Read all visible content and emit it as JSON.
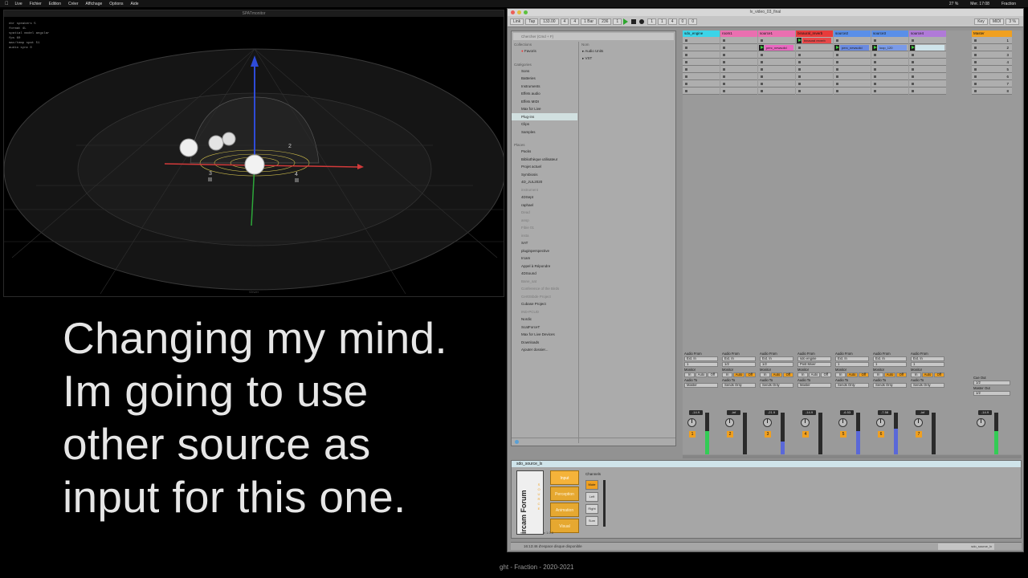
{
  "menubar": {
    "items": [
      "Live",
      "Fichier",
      "Edition",
      "Créer",
      "Affichage",
      "Options",
      "Aide"
    ],
    "status": [
      "27 %",
      "Mer. 17:08",
      "Fraction"
    ]
  },
  "spat": {
    "window_title": "SPATmonitor",
    "info_lines": [
      "nbr speakers 5",
      "format 4L",
      "spatial model angular",
      "fps 60",
      "max/temp spat 51",
      "audio sync 0"
    ],
    "speaker_labels": [
      "2",
      "3",
      "4"
    ],
    "footer": "Viewer"
  },
  "caption": {
    "lines": [
      "Changing my mind.",
      "Im going to use",
      "other source as",
      "input for this one."
    ]
  },
  "credits": "ght - Fraction - 2020-2021",
  "live": {
    "window_title": "lv_video_03_final",
    "control_bar": {
      "items": [
        "Link",
        "Tap",
        "133.00",
        "4",
        "4",
        "1 Bar",
        "236",
        "1",
        "1",
        "1",
        "4",
        "0",
        "0"
      ],
      "key": "Key",
      "midi": "MIDI",
      "cpu": "3 %"
    },
    "browser": {
      "search_placeholder": "Chercher (Cmd + F)",
      "collections_head": "Collections",
      "collections": [
        "Favoris"
      ],
      "categories_head": "Catégories",
      "categories": [
        "Sons",
        "Batteries",
        "Instruments",
        "Effets audio",
        "Effets MIDI",
        "Max for Live",
        "Plug-ins",
        "Clips",
        "Samples"
      ],
      "selected_category": "Plug-ins",
      "places_head": "Places",
      "places": [
        "Packs",
        "Bibliothèque utilisateur",
        "Projet actuel",
        "Symbiosis",
        "4D_JUL2020",
        "instrument",
        "4DSept",
        "raphael",
        "Dead",
        "ansp",
        "Fibie 01",
        "insta",
        "SAT",
        "pluginperspective",
        "Ircam",
        "Appel à Répondre",
        "4DSound",
        "Bane_sat",
        "Conference of the Birds",
        "Cert0Sbde Project",
        "Cubase Project",
        "IND-PCUD",
        "Nordic",
        "ScatForceT",
        "Max for Live Devices",
        "Downloads",
        "Ajouter dossier..."
      ],
      "dim_places": [
        "instrument",
        "Dead",
        "ansp",
        "Fibie 01",
        "insta",
        "Bane_sat",
        "Conference of the Birds",
        "Cert0Sbde Project",
        "IND-PCUD"
      ],
      "right_head": "Nom",
      "right_items": [
        "Audio Units",
        "VST"
      ]
    },
    "tracks": [
      {
        "name": "sdo_engine",
        "color": "#3bd4e8",
        "clips": [],
        "in_from": "Ext. In",
        "in_ch": "1",
        "route": "Master",
        "vol": "-14.9",
        "num": "1",
        "meter": 0.55,
        "meter_color": "#33cc55",
        "mon_on": null
      },
      {
        "name": "room1",
        "color": "#ea6fb0",
        "clips": [],
        "in_from": "Ext. In",
        "in_ch": "1/2",
        "route": "Sends Only",
        "vol": "-inf",
        "num": "2",
        "meter": 0,
        "meter_color": "#33cc55",
        "mon_on": "Auto"
      },
      {
        "name": "source1",
        "color": "#ea6fb0",
        "clips": [
          {
            "slot": 1,
            "label": "perc_newsolid",
            "color": "#e868c0"
          }
        ],
        "in_from": "Ext. In",
        "in_ch": "1/2",
        "route": "Sends Only",
        "vol": "-21.9",
        "num": "3",
        "meter": 0.3,
        "meter_color": "#5a68d8",
        "mon_on": "Auto"
      },
      {
        "name": "binaural_reverb",
        "color": "#e83b3b",
        "clips": [
          {
            "slot": 0,
            "label": "binaural reverb",
            "color": "#e84848"
          }
        ],
        "in_from": "sdo engine",
        "in_ch": "Post Mixer",
        "route": "Master",
        "vol": "-14.9",
        "num": "4",
        "meter": 0,
        "meter_color": "#33cc55",
        "mon_on": null
      },
      {
        "name": "source2",
        "color": "#5a8fe8",
        "clips": [
          {
            "slot": 1,
            "label": "perc_newsolid",
            "color": "#6a8ae0"
          }
        ],
        "in_from": "Ext. In",
        "in_ch": "1",
        "route": "Sends Only",
        "vol": "-6.53",
        "num": "5",
        "meter": 0.55,
        "meter_color": "#5a68d8",
        "mon_on": "Auto"
      },
      {
        "name": "source3",
        "color": "#5a8fe8",
        "clips": [
          {
            "slot": 1,
            "label": "loop_120",
            "color": "#7a9ae8"
          }
        ],
        "in_from": "Ext. In",
        "in_ch": "1",
        "route": "Sends Only",
        "vol": "-7.58",
        "num": "6",
        "meter": 0.62,
        "meter_color": "#5a68d8",
        "mon_on": "Auto"
      },
      {
        "name": "source4",
        "color": "#b07ad8",
        "clips": [
          {
            "slot": 1,
            "label": "",
            "color": "#cfe4ea"
          }
        ],
        "in_from": "Ext. In",
        "in_ch": "1",
        "route": "Sends Only",
        "vol": "-inf",
        "num": "7",
        "meter": 0,
        "meter_color": "#33cc55",
        "mon_on": "Auto"
      }
    ],
    "master": {
      "name": "Master",
      "color": "#f0a020",
      "scenes": [
        "1",
        "2",
        "3",
        "4",
        "5",
        "6",
        "7",
        "8"
      ],
      "cue_out": "Cue Out",
      "cue_ch": "1/2",
      "master_out": "Master Out",
      "master_ch": "1/2",
      "vol": "-14.9",
      "meter": 0.55
    },
    "io_labels": {
      "audio_from": "Audio From",
      "monitor": "Monitor",
      "audio_to": "Audio To",
      "mon_in": "In",
      "mon_auto": "Auto",
      "mon_off": "Off"
    },
    "device": {
      "title": "sdo_source_lx",
      "brand": "ircam",
      "brand2": "Forum",
      "source_vertical": "SOURCE",
      "tabs": [
        "Input",
        "Perception",
        "Animation",
        "Visual"
      ],
      "selected_tab": "Input",
      "channels_label": "Channels",
      "channels": [
        "Mute",
        "Left",
        "Right",
        "Sum"
      ],
      "selected_channel": "Mute",
      "bottom_label": "v 1.0.0"
    },
    "status": {
      "message": "16:13:46 d'espace disque disponible",
      "track_label": "source4",
      "device_label": "sdo_source_lx"
    }
  }
}
